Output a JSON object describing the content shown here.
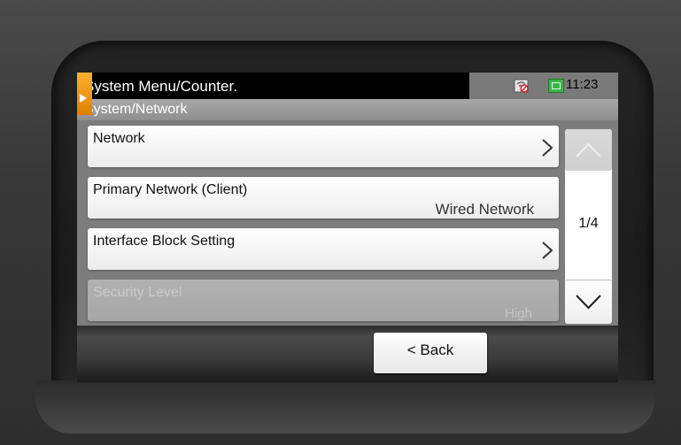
{
  "header": {
    "title": "System Menu/Counter.",
    "subtitle": "System/Network",
    "time": "11:23"
  },
  "icons": {
    "home_tab": "home-tab-icon",
    "network_status": "network-disconnected-icon",
    "clock": "clock-icon"
  },
  "menu": {
    "items": [
      {
        "label": "Network",
        "value": "",
        "enabled": true,
        "has_arrow": true
      },
      {
        "label": "Primary Network (Client)",
        "value": "Wired Network",
        "enabled": true,
        "has_arrow": false
      },
      {
        "label": "Interface Block Setting",
        "value": "",
        "enabled": true,
        "has_arrow": true
      },
      {
        "label": "Security Level",
        "value": "High",
        "enabled": false,
        "has_arrow": false
      }
    ]
  },
  "pager": {
    "indicator": "1/4",
    "up_enabled": false,
    "down_enabled": true
  },
  "footer": {
    "back_label": "< Back"
  },
  "colors": {
    "accent": "#f09000",
    "clock_icon": "#39b54a",
    "panel": "#7d7d7d"
  }
}
